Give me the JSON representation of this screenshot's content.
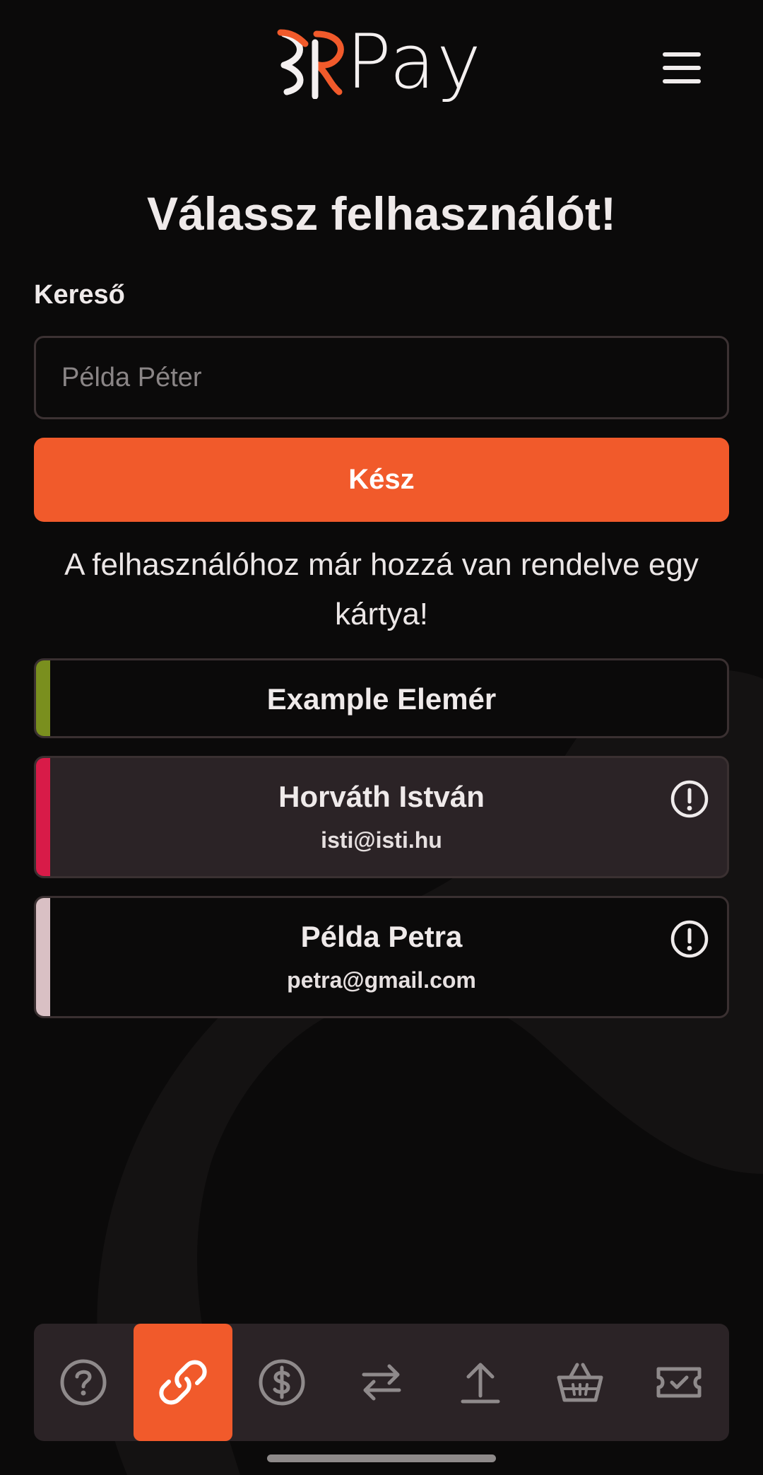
{
  "header": {
    "logo_text": "Pay",
    "logo_icon": "xr-logo-mark",
    "menu_icon": "hamburger-menu-icon"
  },
  "page": {
    "title": "Válassz felhasználót!",
    "search_label": "Kereső",
    "search_placeholder": "Példa Péter",
    "search_value": "",
    "done_label": "Kész",
    "notice": "A felhasználóhoz már hozzá van rendelve egy kártya!"
  },
  "users": [
    {
      "name": "Example Elemér",
      "email": "",
      "accent": "#7a8f1e",
      "warning": false
    },
    {
      "name": "Horváth István",
      "email": "isti@isti.hu",
      "accent": "#d81b48",
      "warning": true
    },
    {
      "name": "Példa Petra",
      "email": "petra@gmail.com",
      "accent": "#d9c0c4",
      "warning": true
    }
  ],
  "bottom_nav": {
    "items": [
      {
        "icon": "help-circle-icon",
        "active": false
      },
      {
        "icon": "link-icon",
        "active": true
      },
      {
        "icon": "dollar-circle-icon",
        "active": false
      },
      {
        "icon": "transfer-arrows-icon",
        "active": false
      },
      {
        "icon": "upload-icon",
        "active": false
      },
      {
        "icon": "basket-icon",
        "active": false
      },
      {
        "icon": "ticket-check-icon",
        "active": false
      }
    ]
  },
  "colors": {
    "background": "#0b0a0a",
    "accent": "#f15a2b",
    "card_highlight": "#2b2326",
    "text": "#efeaea"
  }
}
